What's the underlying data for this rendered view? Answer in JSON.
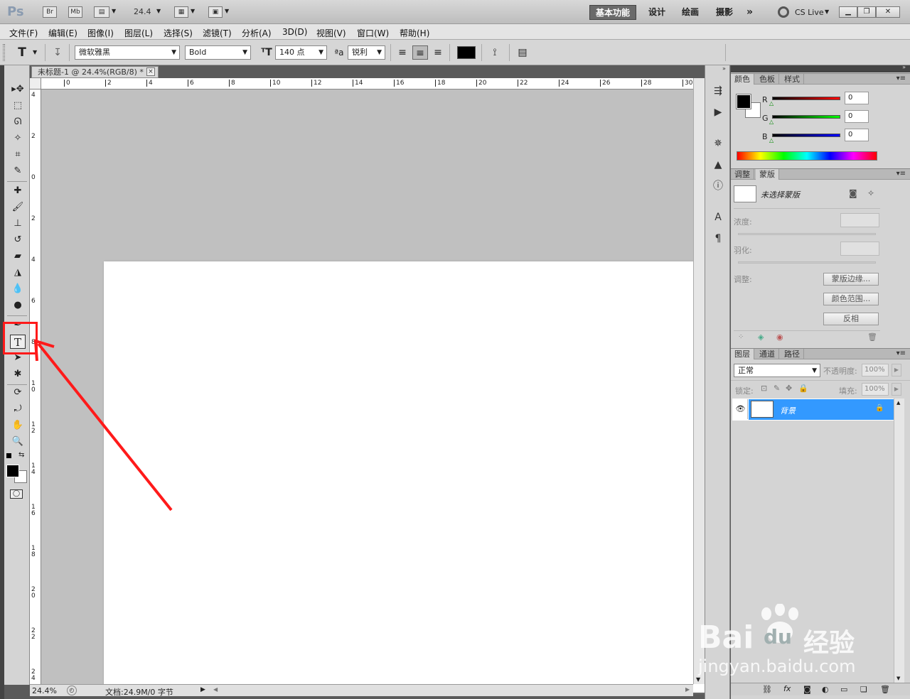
{
  "titlebar": {
    "logo": "Ps",
    "bridge_label": "Br",
    "minibridge_label": "Mb",
    "zoom": "24.4",
    "workspaces": [
      "基本功能",
      "设计",
      "绘画",
      "摄影"
    ],
    "more": "»",
    "cslive": "CS Live"
  },
  "menu": [
    "文件(F)",
    "编辑(E)",
    "图像(I)",
    "图层(L)",
    "选择(S)",
    "滤镜(T)",
    "分析(A)",
    "3D(D)",
    "视图(V)",
    "窗口(W)",
    "帮助(H)"
  ],
  "options": {
    "tool_icon": "T",
    "font_family": "微软雅黑",
    "font_style": "Bold",
    "font_size": "140 点",
    "antialias_icon": "ªa",
    "antialias": "锐利",
    "text_color": "#000000"
  },
  "document": {
    "tab_title": "未标题-1 @ 24.4%(RGB/8) *",
    "close_icon": "×",
    "ruler_h": [
      "0",
      "2",
      "4",
      "6",
      "8",
      "10",
      "12",
      "14",
      "16",
      "18",
      "20",
      "22",
      "24",
      "26",
      "28",
      "30"
    ],
    "ruler_v": [
      "4",
      "2",
      "0",
      "2",
      "4",
      "6",
      "8",
      "10",
      "12",
      "14",
      "16",
      "18",
      "20",
      "22",
      "24"
    ],
    "status_zoom": "24.4%",
    "status_doc": "文档:24.9M/0 字节"
  },
  "color_panel": {
    "tabs": [
      "颜色",
      "色板",
      "样式"
    ],
    "channels": [
      {
        "label": "R",
        "value": "0",
        "gradient": "#ff0000"
      },
      {
        "label": "G",
        "value": "0",
        "gradient": "#00ff00"
      },
      {
        "label": "B",
        "value": "0",
        "gradient": "#0000ff"
      }
    ]
  },
  "masks_panel": {
    "tabs": [
      "调整",
      "蒙版"
    ],
    "title": "未选择蒙版",
    "density_label": "浓度:",
    "feather_label": "羽化:",
    "refine_label": "调整:",
    "btn_edge": "蒙版边缘...",
    "btn_range": "颜色范围...",
    "btn_invert": "反相"
  },
  "layers_panel": {
    "tabs": [
      "图层",
      "通道",
      "路径"
    ],
    "blend_mode": "正常",
    "opacity_label": "不透明度:",
    "opacity": "100%",
    "lock_label": "锁定:",
    "fill_label": "填充:",
    "fill": "100%",
    "layer_name": "背景",
    "footer_fx": "fx"
  },
  "watermark": {
    "brand": "Bai",
    "brand2": "du",
    "cn": "经验",
    "url": "jingyan.baidu.com"
  },
  "colors": {
    "accent": "#3399ff",
    "highlight": "#ff1a1a"
  }
}
